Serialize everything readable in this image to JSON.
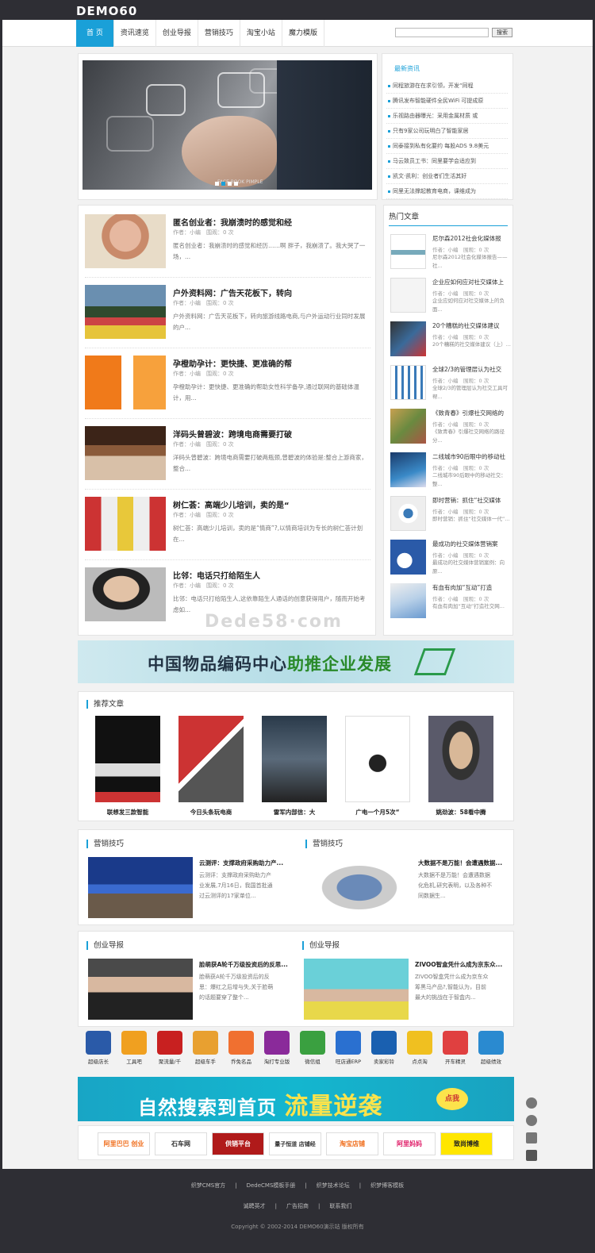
{
  "header": {
    "logo": "DEMO60",
    "search_button": "搜索"
  },
  "nav": [
    "首 页",
    "资讯速览",
    "创业导报",
    "营销技巧",
    "淘宝小站",
    "魔力模版"
  ],
  "slider": {
    "caption": "FACE BOOK PIMPLE"
  },
  "latest": {
    "title": "最新资讯",
    "items": [
      "同程旅游在在求引领，开发“同程",
      "腾讯发布智能硬件全民WiFi 可提成原",
      "乐视路由器曝光：采用金属材质 或",
      "只有9家公司玩明白了智能家居",
      "同泰接到私有化要约 每股ADS 9.8美元",
      "马云致员工书：同里要学会适应到",
      "凯文·凯利：创业者们生活其好",
      "同里无法撑起教育电商，课维成为"
    ]
  },
  "articles": [
    {
      "title": "匿名创业者：我崩溃时的感觉和经",
      "meta": "作者：小编　围观：0 次",
      "desc": "匿名创业者：我崩溃时的感觉和经历……啊 胖子，我崩溃了。我大哭了一场，..."
    },
    {
      "title": "户外资料网：广告天花板下，转向",
      "meta": "作者：小编　围观：0 次",
      "desc": "户外资料网：广告天花板下，转向旅游线路电商,与户外运动行业同时发展的户..."
    },
    {
      "title": "孕橙助孕计：更快捷、更准确的帮",
      "meta": "作者：小编　围观：0 次",
      "desc": "孕橙助孕计：更快捷、更准确的帮助女性科学备孕,通过联网的基础体温计，用..."
    },
    {
      "title": "洋码头曾碧波：跨境电商需要打破",
      "meta": "作者：小编　围观：0 次",
      "desc": "洋码头曾碧波：跨境电商需要打破两瓶颈,曾碧波的体验是:整合上游商家，整合..."
    },
    {
      "title": "树仁荟：高端少儿培训，卖的是“",
      "meta": "作者：小编　围观：0 次",
      "desc": "树仁荟：高端少儿培训，卖的是“情商”?,以情商培训为专长的树仁荟计划在..."
    },
    {
      "title": "比邻：电话只打给陌生人",
      "meta": "作者：小编　围观：0 次",
      "desc": "比邻：电话只打给陌生人,这依靠陌生人通话的创意获得用户，随而开始考虑如..."
    }
  ],
  "hot": {
    "title": "热门文章",
    "items": [
      {
        "title": "尼尔森2012社会化媒体报",
        "meta": "作者：小编　围观：0 次",
        "desc": "尼尔森2012社会化媒体报告——社..."
      },
      {
        "title": "企业应如何应对社交媒体上",
        "meta": "作者：小编　围观：0 次",
        "desc": "企业应如何应对社交媒体上的负面..."
      },
      {
        "title": "20个糟糕的社交媒体建议",
        "meta": "作者：小编　围观：0 次",
        "desc": "20个糟糕的社交媒体建议（上）..."
      },
      {
        "title": "全球2/3的管理层认为社交",
        "meta": "作者：小编　围观：0 次",
        "desc": "全球2/3的管理层认为社交工具可帮..."
      },
      {
        "title": "《致青春》引爆社交网络的",
        "meta": "作者：小编　围观：0 次",
        "desc": "《致青春》引爆社交网络的路径分..."
      },
      {
        "title": "二线城市90后眼中的移动社",
        "meta": "作者：小编　围观：0 次",
        "desc": "二线城市90后眼中的移动社交：整..."
      },
      {
        "title": "即时营销：抓住“社交媒体",
        "meta": "作者：小编　围观：0 次",
        "desc": "即时营销：抓住“社交媒体一代”..."
      },
      {
        "title": "最成功的社交媒体营销案",
        "meta": "作者：小编　围观：0 次",
        "desc": "最成功的社交媒体营销案例：向原..."
      },
      {
        "title": "有血有肉加“互动”打造",
        "meta": "作者：小编　围观：0 次",
        "desc": "有血有肉加“互动”打造社交网..."
      }
    ]
  },
  "watermark": "Dede58·com",
  "banner1": {
    "a": "中国物品编码中心",
    "b": "助推企业发展"
  },
  "recommend": {
    "title": "推荐文章",
    "items": [
      "联想发三款智能",
      "今日头条玩电商",
      "雷军内部信：大",
      "广电一个月5次“",
      "姚劲波：58看中腾"
    ]
  },
  "marketing": {
    "left": {
      "section": "营销技巧",
      "title": "云测评：支撑政府采购助力产...",
      "desc": "云测评：支撑政府采购助力产业发展,7月16日，我国首批通过云测评的17家单位..."
    },
    "right": {
      "section": "营销技巧",
      "title": "大数据不是万能！会遭遇数据...",
      "desc": "大数据不是万能！会遭遇数据化危机,研究表明，以及各种不同数据生..."
    }
  },
  "startup": {
    "left": {
      "section": "创业导报",
      "title": "脸萌获A轮千万级投资后的反思...",
      "desc": "脸萌获A轮千万级投资后的反思：爆红之后增与失,关于脸萌的话题要穿了整个..."
    },
    "right": {
      "section": "创业导报",
      "title": "ZIVOO智盒凭什么成为京东众...",
      "desc": "ZIVOO智盒凭什么成为京东众筹黑马产品?,智能认为，目前最大的挑战在于智盒内..."
    }
  },
  "app_icons": [
    "超级店长",
    "工具吧",
    "聚流量/千",
    "超级车手",
    "乔免名品",
    "淘打专业版",
    "微信组",
    "旺店通ERP",
    "卖家彩铃",
    "点点淘",
    "开车精灵",
    "超级绩效"
  ],
  "banner2": {
    "a": "自然搜索到首页",
    "b": "流量逆袭",
    "btn": "点我"
  },
  "partners": [
    "阿里巴巴 创业",
    "石车网",
    "供销平台",
    "量子恒道 店铺经",
    "淘宝店铺",
    "阿里妈妈",
    "致尚博维"
  ],
  "footer": {
    "links1": [
      "织梦CMS官方",
      "|",
      "DedeCMS模板手册",
      "|",
      "织梦技术论坛",
      "|",
      "织梦博客模板"
    ],
    "links2": [
      "诚聘英才",
      "|",
      "广告招商",
      "|",
      "联系我们"
    ],
    "copyright": "Copyright © 2002-2014 DEMO60演示站 版权所有"
  },
  "colors": {
    "accent": "#1aa0d8",
    "topbar": "#2e2e34"
  }
}
